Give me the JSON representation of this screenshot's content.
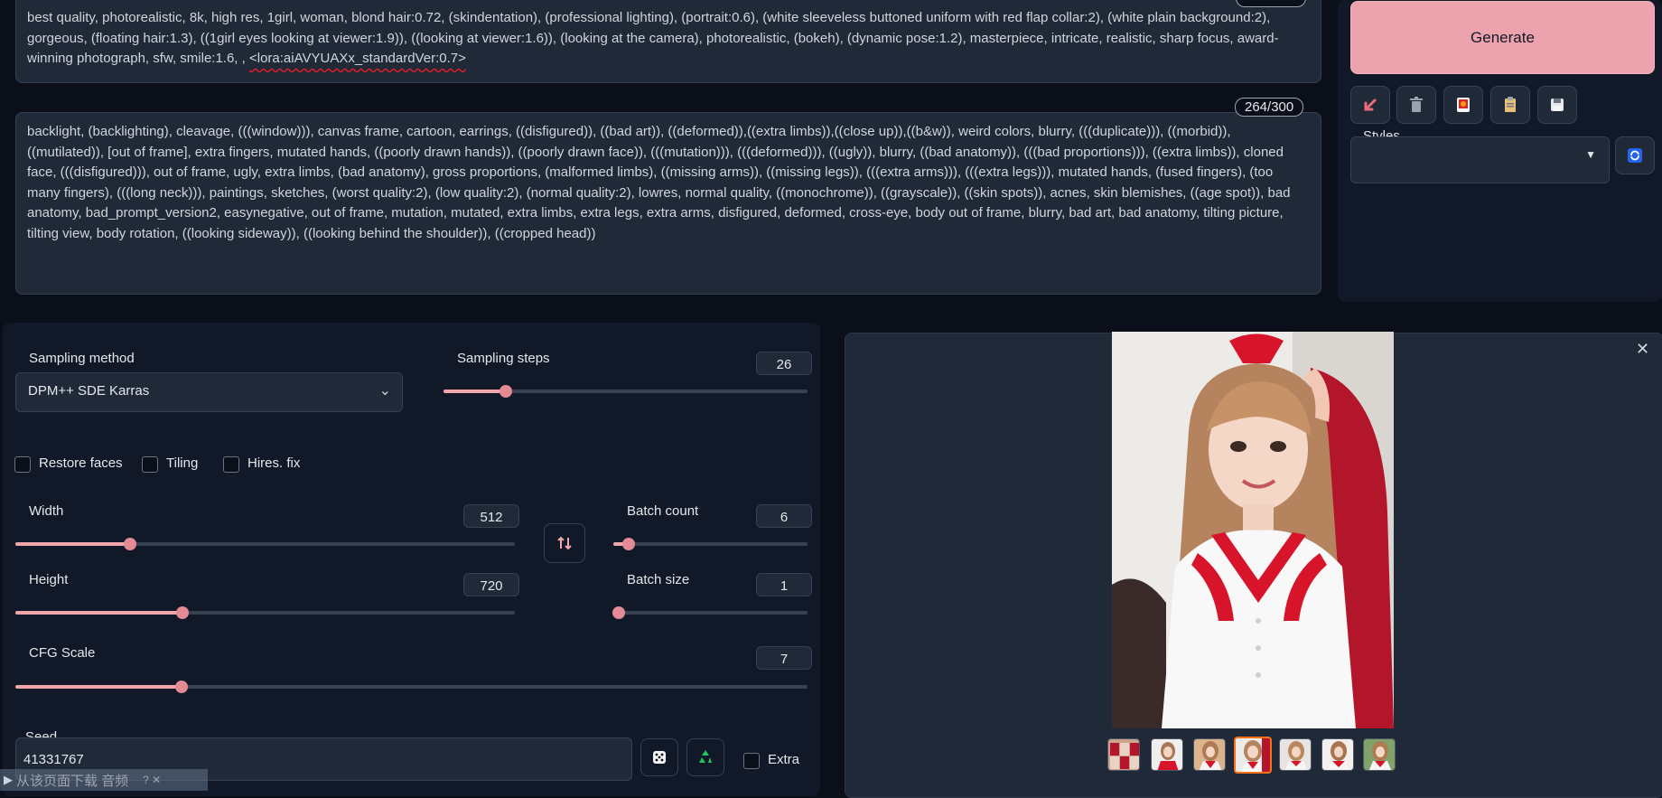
{
  "positive_prompt": {
    "text": "best quality, photorealistic, 8k, high res, 1girl, woman, blond hair:0.72, (skindentation), (professional lighting), (portrait:0.6), (white sleeveless buttoned uniform with red flap collar:2), (white plain background:2), gorgeous, (floating hair:1.3), ((1girl eyes looking at viewer:1.9)), ((looking at viewer:1.6)), (looking at the camera), photorealistic, (bokeh), (dynamic pose:1.2), masterpiece, intricate, realistic, sharp focus, award-winning photograph, sfw, smile:1.6, ,",
    "lora": "<lora:aiAVYUAXx_standardVer:0.7>"
  },
  "negative_prompt": {
    "counter": "264/300",
    "text": "backlight, (backlighting), cleavage, (((window))), canvas frame, cartoon, earrings, ((disfigured)), ((bad art)), ((deformed)),((extra limbs)),((close up)),((b&w)), weird colors, blurry, (((duplicate))), ((morbid)), ((mutilated)), [out of frame], extra fingers, mutated hands, ((poorly drawn hands)), ((poorly drawn face)), (((mutation))), (((deformed))), ((ugly)), blurry, ((bad anatomy)), (((bad proportions))), ((extra limbs)), cloned face, (((disfigured))), out of frame, ugly, extra limbs, (bad anatomy), gross proportions, (malformed limbs), ((missing arms)), ((missing legs)), (((extra arms))), (((extra legs))), mutated hands, (fused fingers), (too many fingers), (((long neck))), paintings, sketches, (worst quality:2), (low quality:2), (normal quality:2), lowres, normal quality, ((monochrome)), ((grayscale)), ((skin spots)), acnes, skin blemishes, ((age spot)), bad anatomy, bad_prompt_version2, easynegative, out of frame, mutation, mutated, extra limbs, extra legs, extra arms, disfigured, deformed, cross-eye, body out of frame, blurry, bad art, bad anatomy, tilting picture, tilting view, body rotation, ((looking sideway)), ((looking behind the shoulder)), ((cropped head))"
  },
  "generate_label": "Generate",
  "styles_label": "Styles",
  "sampling": {
    "method_label": "Sampling method",
    "method_value": "DPM++ SDE Karras",
    "steps_label": "Sampling steps",
    "steps_value": "26",
    "steps_fraction": 0.17
  },
  "checkboxes": {
    "restore_faces": "Restore faces",
    "tiling": "Tiling",
    "hires_fix": "Hires. fix"
  },
  "width": {
    "label": "Width",
    "value": "512",
    "fraction": 0.23
  },
  "height": {
    "label": "Height",
    "value": "720",
    "fraction": 0.335
  },
  "batch_count": {
    "label": "Batch count",
    "value": "6",
    "fraction": 0.08
  },
  "batch_size": {
    "label": "Batch size",
    "value": "1",
    "fraction": 0.0
  },
  "cfg_scale": {
    "label": "CFG Scale",
    "value": "7",
    "fraction": 0.21
  },
  "seed": {
    "label": "Seed",
    "value": "41331767",
    "extra_label": "Extra"
  },
  "watermark_text": "从该页面下载 音频",
  "watermark_extra": "? ✕",
  "colors": {
    "accent": "#f3a5ac",
    "generate_bg": "#eca3ad",
    "background": "#0b0f19",
    "panel": "#1f2937"
  }
}
